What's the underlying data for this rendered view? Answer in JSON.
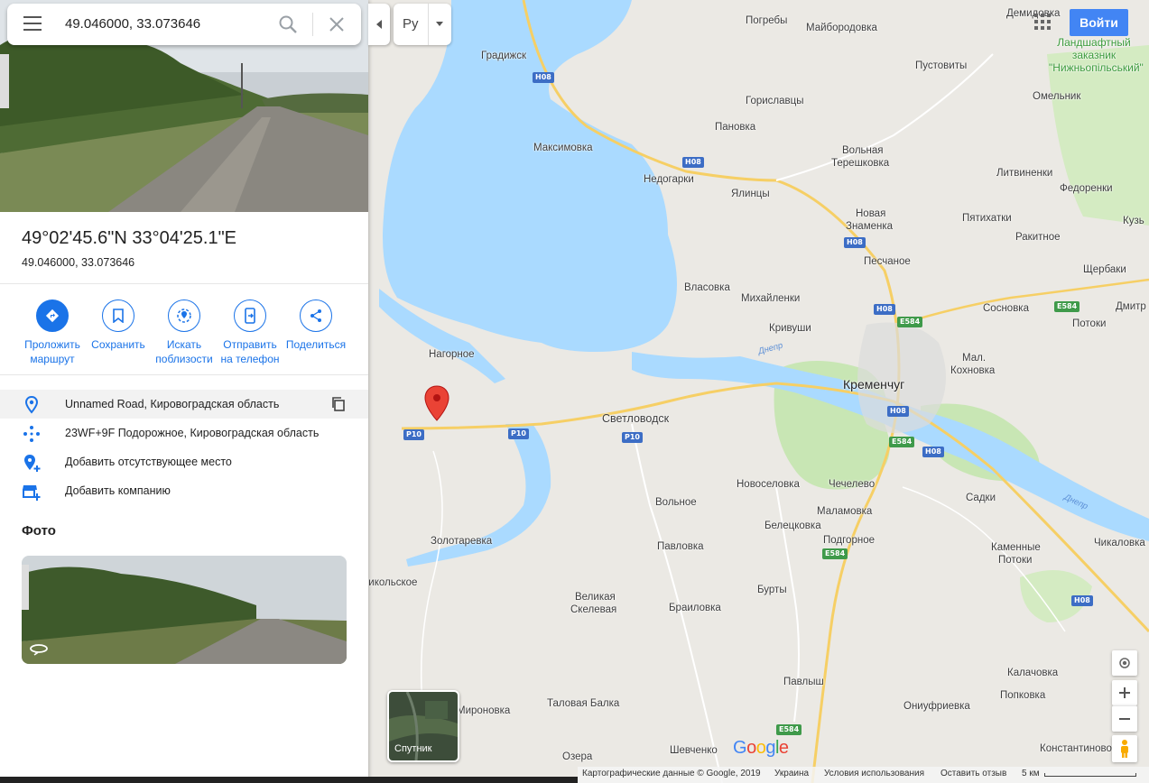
{
  "search": {
    "query": "49.046000, 33.073646"
  },
  "place": {
    "title": "49°02'45.6\"N 33°04'25.1\"E",
    "subtitle": "49.046000, 33.073646"
  },
  "actions": [
    {
      "label1": "Проложить",
      "label2": "маршрут",
      "icon": "directions-icon"
    },
    {
      "label1": "Сохранить",
      "label2": "",
      "icon": "bookmark-icon"
    },
    {
      "label1": "Искать",
      "label2": "поблизости",
      "icon": "nearby-icon"
    },
    {
      "label1": "Отправить",
      "label2": "на телефон",
      "icon": "send-to-phone-icon"
    },
    {
      "label1": "Поделиться",
      "label2": "",
      "icon": "share-icon"
    }
  ],
  "info": {
    "address": "Unnamed Road, Кировоградская область",
    "pluscode": "23WF+9F Подорожное, Кировоградская область",
    "add_place": "Добавить отсутствующее место",
    "add_business": "Добавить компанию"
  },
  "photos_heading": "Фото",
  "lang": "Ру",
  "login": "Войти",
  "satellite_label": "Спутник",
  "logo": "Google",
  "footer": {
    "copyright": "Картографические данные © Google, 2019",
    "country": "Украина",
    "terms": "Условия использования",
    "feedback": "Оставить отзыв",
    "scale": "5 км"
  },
  "map": {
    "big_city": "Кременчуг",
    "park": "Ландшафтный заказник \"Нижньопільський\"",
    "river": "Днепр",
    "places": [
      "Демидовка",
      "Погребы",
      "Майбородовка",
      "Градижск",
      "Пустовиты",
      "Омельник",
      "Гориславцы",
      "Пановка",
      "Максимовка",
      "Вольная",
      "Терешковка",
      "Литвиненки",
      "Федоренки",
      "Недогарки",
      "Ялинцы",
      "Новая",
      "Знаменка",
      "Пятихатки",
      "Ракитное",
      "Кузь",
      "Песчаное",
      "Щербаки",
      "Власовка",
      "Михайленки",
      "Сосновка",
      "Дмитр",
      "Кривуши",
      "Потоки",
      "Нагорное",
      "Мал.",
      "Кохновка",
      "Светловодск",
      "Садки",
      "Новоселовка",
      "Чечелево",
      "Маламовка",
      "Вольное",
      "Белецковка",
      "Подгорное",
      "Каменные",
      "Потоки",
      "Чикаловка",
      "Золотаревка",
      "Павловка",
      "Никольское",
      "Бурты",
      "Великая",
      "Скелевая",
      "Браиловка",
      "Калачовка",
      "Попковка",
      "Павлыш",
      "Ониуфриевка",
      "Мироновка",
      "Таловая Балка",
      "Озера",
      "Шевченко",
      "Константиново"
    ]
  },
  "colors": {
    "accent": "#1a73e8",
    "water": "#aadaff",
    "park": "#c8e6b4",
    "pin": "#ea4335"
  }
}
